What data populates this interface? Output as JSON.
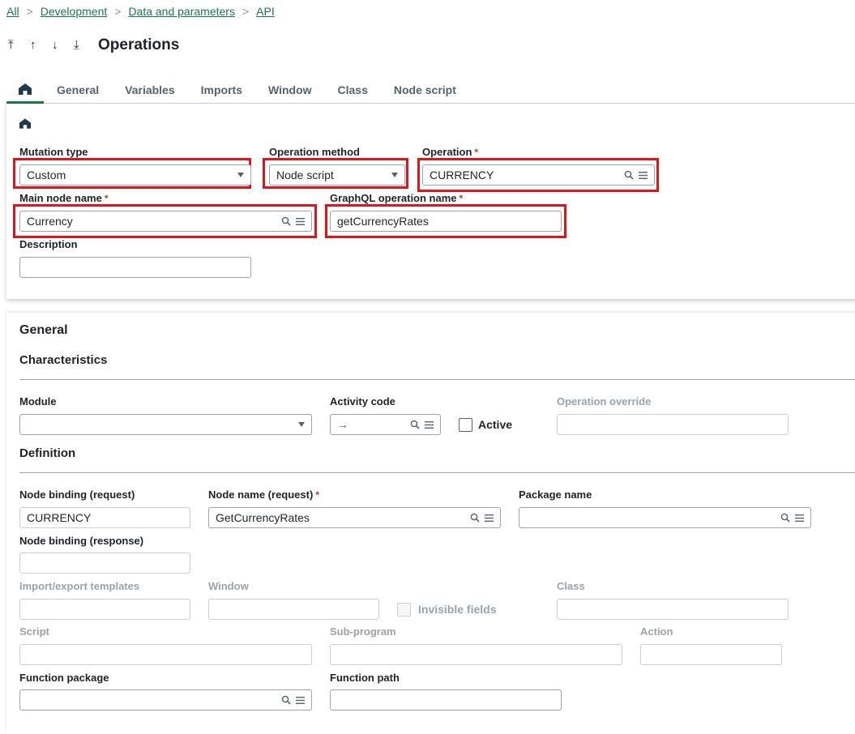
{
  "breadcrumb": {
    "items": [
      "All",
      "Development",
      "Data and parameters",
      "API"
    ],
    "separator": ">"
  },
  "header": {
    "nav": [
      "⤒",
      "↑",
      "↓",
      "⤓"
    ],
    "title": "Operations"
  },
  "tabs": [
    "General",
    "Variables",
    "Imports",
    "Window",
    "Class",
    "Node script"
  ],
  "icons": {
    "home": "home-icon",
    "search": "search-icon",
    "list": "list-icon",
    "dropdown": "chevron-down-icon",
    "arrow": "arrow-right-icon"
  },
  "colors": {
    "accent": "#1a7a4a",
    "highlight": "#e0141e",
    "required": "#c0392b"
  },
  "top": {
    "mutation_type": {
      "label": "Mutation type",
      "value": "Custom"
    },
    "operation_method": {
      "label": "Operation method",
      "value": "Node script"
    },
    "operation": {
      "label": "Operation",
      "value": "CURRENCY"
    },
    "main_node_name": {
      "label": "Main node name",
      "value": "Currency"
    },
    "graphql_operation_name": {
      "label": "GraphQL operation name",
      "value": "getCurrencyRates"
    },
    "description": {
      "label": "Description",
      "value": ""
    },
    "required_mark": "*"
  },
  "general": {
    "title": "General",
    "characteristics": {
      "title": "Characteristics",
      "module": {
        "label": "Module",
        "value": ""
      },
      "activity_code": {
        "label": "Activity code",
        "value": "→"
      },
      "active": {
        "label": "Active",
        "checked": false
      },
      "operation_override": {
        "label": "Operation override",
        "value": ""
      }
    },
    "definition": {
      "title": "Definition",
      "node_binding_request": {
        "label": "Node binding (request)",
        "value": "CURRENCY"
      },
      "node_name_request": {
        "label": "Node name (request)",
        "value": "GetCurrencyRates"
      },
      "package_name": {
        "label": "Package name",
        "value": ""
      },
      "node_binding_response": {
        "label": "Node binding (response)",
        "value": ""
      },
      "import_export_templates": {
        "label": "Import/export templates",
        "value": ""
      },
      "window": {
        "label": "Window",
        "value": ""
      },
      "invisible_fields": {
        "label": "Invisible fields",
        "checked": false
      },
      "class": {
        "label": "Class",
        "value": ""
      },
      "script": {
        "label": "Script",
        "value": ""
      },
      "sub_program": {
        "label": "Sub-program",
        "value": ""
      },
      "action": {
        "label": "Action",
        "value": ""
      },
      "function_package": {
        "label": "Function package",
        "value": ""
      },
      "function_path": {
        "label": "Function path",
        "value": ""
      }
    }
  }
}
